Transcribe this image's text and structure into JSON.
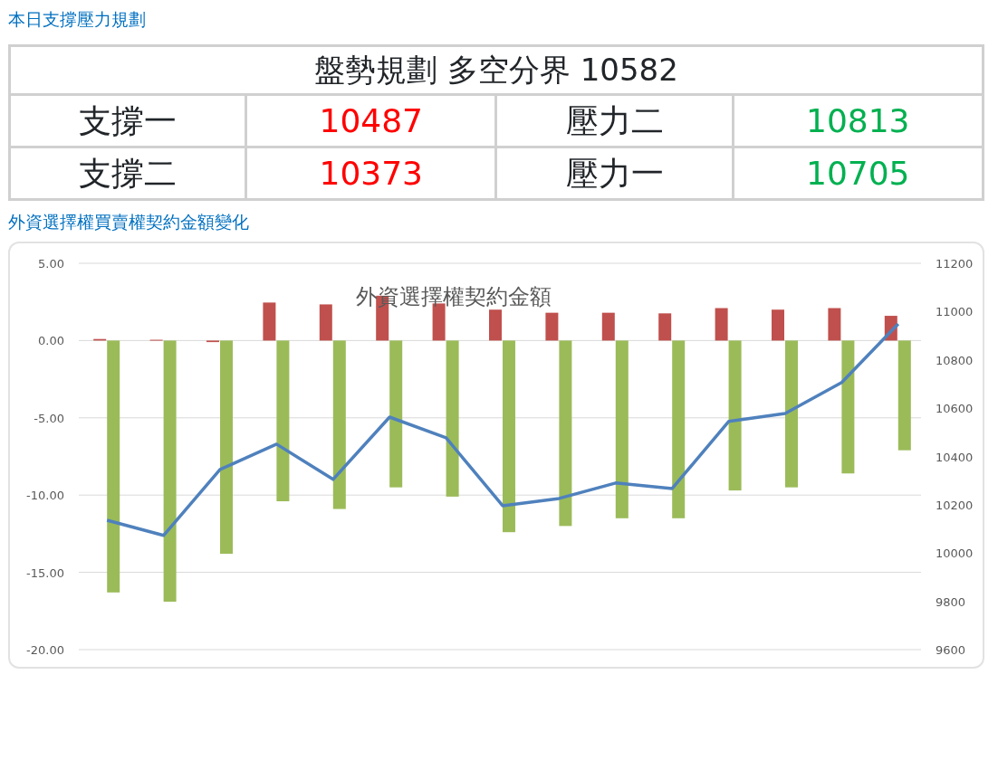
{
  "plan_heading": "本日支撐壓力規劃",
  "plan_table": {
    "caption": "盤勢規劃 多空分界 10582",
    "rows": [
      [
        {
          "text": "支撐一",
          "kind": "label"
        },
        {
          "text": "10487",
          "kind": "value",
          "color": "#ff0000"
        },
        {
          "text": "壓力二",
          "kind": "label"
        },
        {
          "text": "10813",
          "kind": "value",
          "color": "#00b050"
        }
      ],
      [
        {
          "text": "支撐二",
          "kind": "label"
        },
        {
          "text": "10373",
          "kind": "value",
          "color": "#ff0000"
        },
        {
          "text": "壓力一",
          "kind": "label"
        },
        {
          "text": "10705",
          "kind": "value",
          "color": "#00b050"
        }
      ]
    ]
  },
  "chart_section": {
    "heading": "外資選擇權買賣權契約金額變化",
    "chart_data": {
      "type": "bar",
      "grid": true,
      "title": "外資選擇權契約金額",
      "ylim": [
        -20,
        5
      ],
      "yticks": [
        {
          "value": 5,
          "label": "5.00"
        },
        {
          "value": 0,
          "label": "0.00"
        },
        {
          "value": -5,
          "label": "-5.00"
        },
        {
          "value": -10,
          "label": "-10.00"
        },
        {
          "value": -15,
          "label": "-15.00"
        },
        {
          "value": -20,
          "label": "-20.00"
        }
      ],
      "y2lim": [
        9600,
        11200
      ],
      "y2ticks": [
        9600,
        9800,
        10000,
        10200,
        10400,
        10600,
        10800,
        11000,
        11200
      ],
      "series": [
        {
          "color": "#c0504d",
          "values": [
            0.1,
            0.05,
            -0.1,
            2.46,
            2.34,
            2.9,
            2.4,
            2.0,
            1.8,
            1.8,
            1.76,
            2.1,
            2.0,
            2.1,
            1.6
          ]
        },
        {
          "color": "#9bbb59",
          "values": [
            -16.3,
            -16.9,
            -13.8,
            -10.4,
            -10.9,
            -9.5,
            -10.1,
            -12.4,
            -12.0,
            -11.5,
            -11.5,
            -9.7,
            -9.5,
            -8.6,
            -7.1
          ]
        },
        {
          "type": "line",
          "axis": "y2",
          "color": "#4f81bd",
          "values": [
            10136,
            10073,
            10346,
            10451,
            10305,
            10563,
            10477,
            10196,
            10226,
            10290,
            10267,
            10545,
            10578,
            10706,
            10949
          ]
        }
      ]
    }
  }
}
